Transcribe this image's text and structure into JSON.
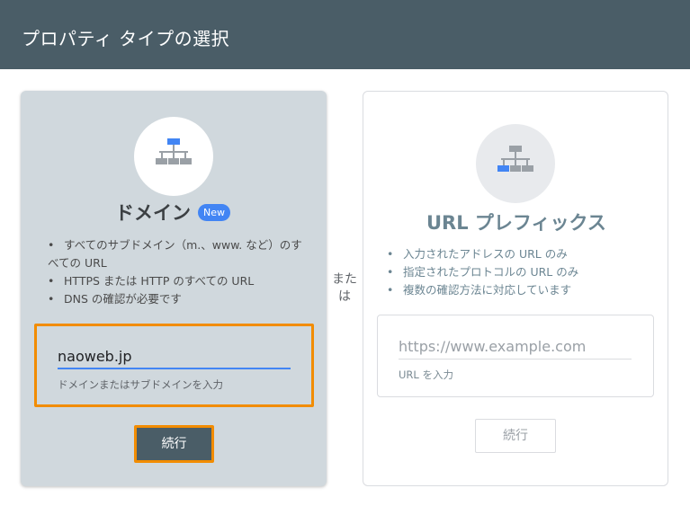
{
  "header": {
    "title": "プロパティ タイプの選択"
  },
  "domain_card": {
    "title": "ドメイン",
    "badge": "New",
    "features": [
      "すべてのサブドメイン（m.、www. など）のすべての URL",
      "HTTPS または HTTP のすべての URL",
      "DNS の確認が必要です"
    ],
    "input_value": "naoweb.jp",
    "helper": "ドメインまたはサブドメインを入力",
    "continue_label": "続行"
  },
  "or_label": "また\nは",
  "url_card": {
    "title": "URL プレフィックス",
    "features": [
      "入力されたアドレスの URL のみ",
      "指定されたプロトコルの URL のみ",
      "複数の確認方法に対応しています"
    ],
    "placeholder": "https://www.example.com",
    "helper": "URL を入力",
    "continue_label": "続行"
  },
  "colors": {
    "header": "#4a5d67",
    "accent_blue": "#4285f4",
    "highlight_orange": "#f28c00",
    "domain_card_bg": "#d0d8dd"
  },
  "icons": {
    "domain": "sitemap-icon",
    "url": "sitemap-icon"
  }
}
